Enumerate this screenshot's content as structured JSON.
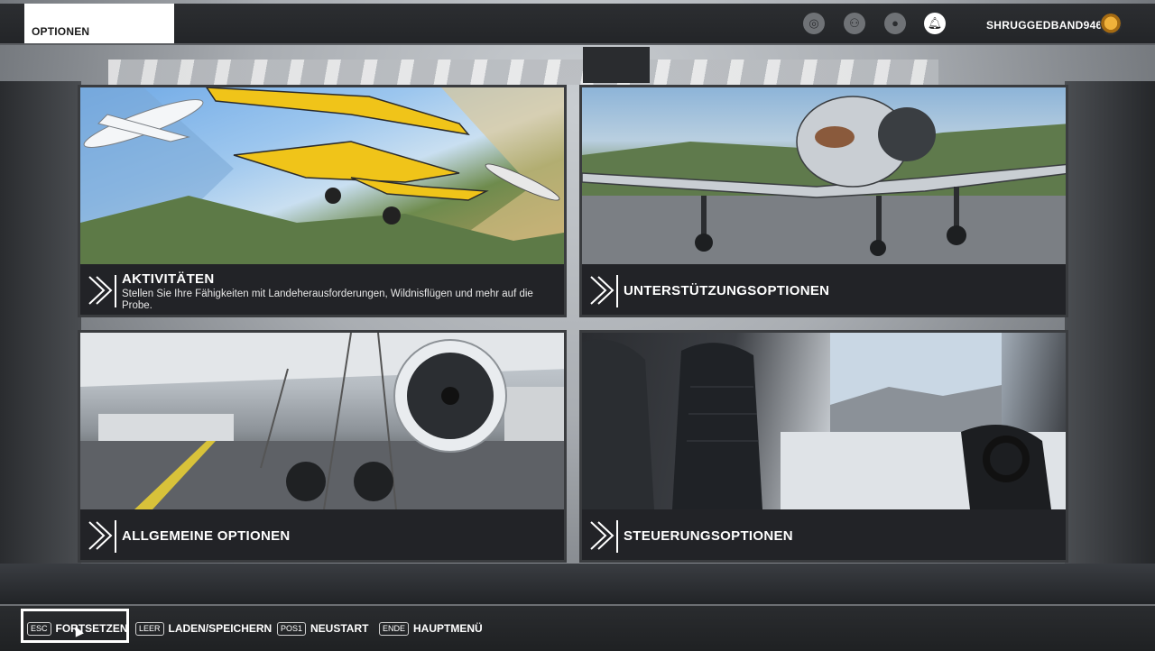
{
  "header": {
    "tab_label": "OPTIONEN",
    "icons": [
      "achievements-icon",
      "friends-icon",
      "profile-icon",
      "notifications-icon"
    ],
    "username": "SHRUGGEDBAND946"
  },
  "tiles": [
    {
      "title": "AKTIVITÄTEN",
      "description": "Stellen Sie Ihre Fähigkeiten mit Landeherausforderungen, Wildnisflügen und mehr auf die Probe."
    },
    {
      "title": "UNTERSTÜTZUNGSOPTIONEN"
    },
    {
      "title": "ALLGEMEINE OPTIONEN"
    },
    {
      "title": "STEUERUNGSOPTIONEN"
    }
  ],
  "footer": {
    "items": [
      {
        "key": "ESC",
        "label": "FORTSETZEN"
      },
      {
        "key": "LEER",
        "label": "LADEN/SPEICHERN"
      },
      {
        "key": "POS1",
        "label": "NEUSTART"
      },
      {
        "key": "ENDE",
        "label": "HAUPTMENÜ"
      }
    ]
  },
  "colors": {
    "accent": "#ffffff",
    "bar": "#232528",
    "avatar": "#f0b13a"
  }
}
